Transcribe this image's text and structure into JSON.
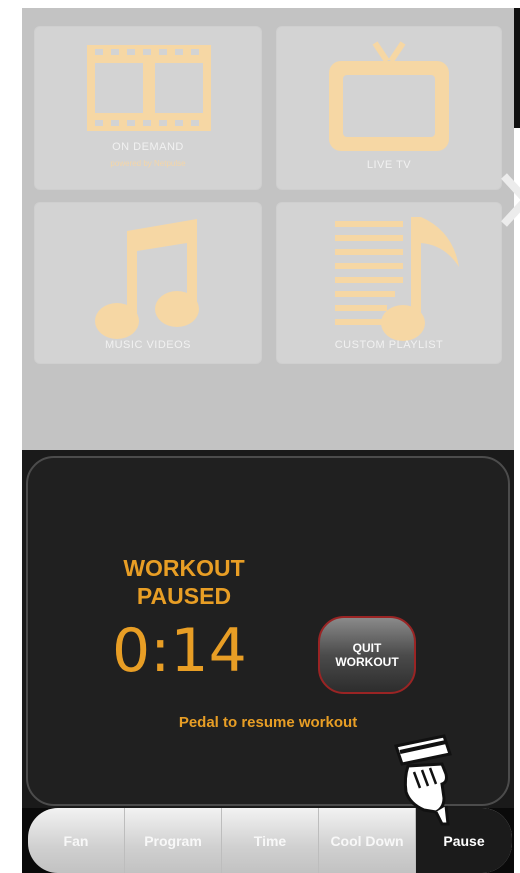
{
  "media_menu": {
    "tiles": [
      {
        "label": "ON DEMAND",
        "sub": "powered by Netpulse"
      },
      {
        "label": "LIVE TV"
      },
      {
        "label": "MUSIC VIDEOS"
      },
      {
        "label": "CUSTOM PLAYLIST"
      }
    ],
    "next_icon": "chevron-right-icon"
  },
  "console": {
    "status_line1": "WORKOUT",
    "status_line2": "PAUSED",
    "timer": "0:14",
    "quit_line1": "QUIT",
    "quit_line2": "WORKOUT",
    "hint": "Pedal to resume workout"
  },
  "nav": {
    "items": [
      {
        "label": "Fan"
      },
      {
        "label": "Program"
      },
      {
        "label": "Time"
      },
      {
        "label": "Cool Down"
      },
      {
        "label": "Pause",
        "active": true
      }
    ]
  },
  "colors": {
    "accent": "#e89e25",
    "icon_tint": "#f6d7a4",
    "panel_gray": "#c3c3c3",
    "console_bg": "#1a1a1a"
  }
}
